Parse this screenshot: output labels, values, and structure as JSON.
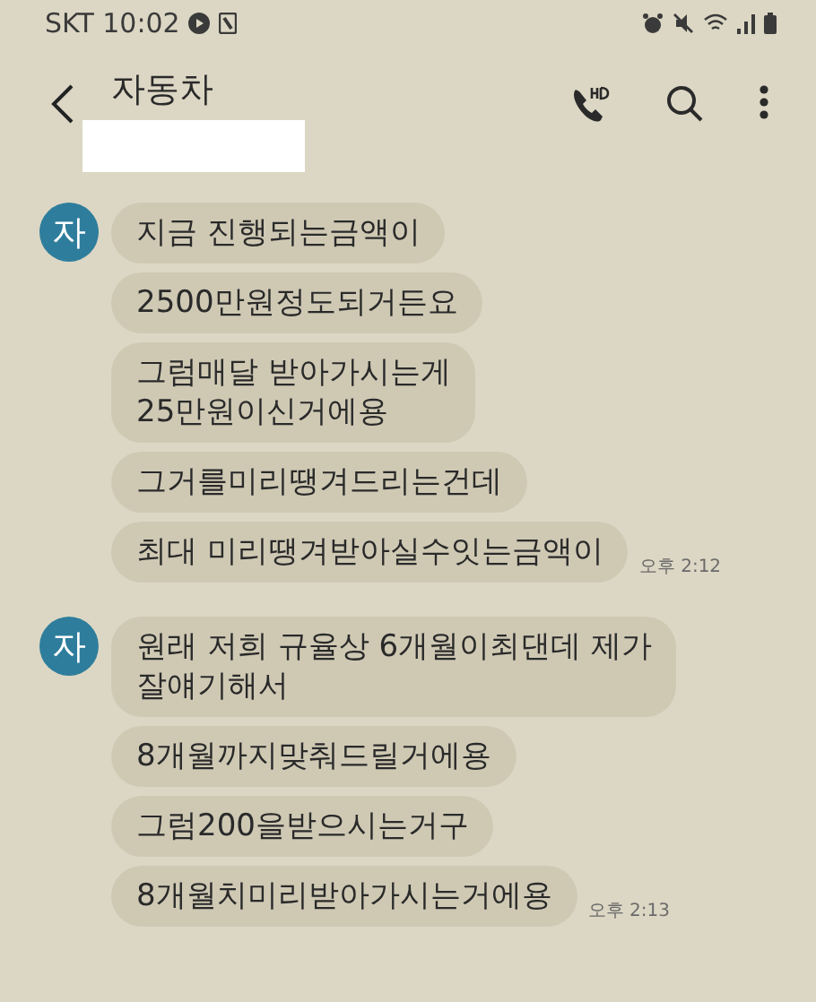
{
  "status_bar": {
    "carrier": "SKT",
    "time": "10:02"
  },
  "header": {
    "title": "자동차"
  },
  "groups": [
    {
      "avatar": "자",
      "messages": [
        "지금 진행되는금액이",
        "2500만원정도되거든요",
        "그럼매달 받아가시는게\n25만원이신거에용",
        "그거를미리땡겨드리는건데",
        "최대 미리땡겨받아실수잇는금액이"
      ],
      "time": "오후 2:12"
    },
    {
      "avatar": "자",
      "messages": [
        "원래 저희 규율상 6개월이최댄데 제가\n잘얘기해서",
        "8개월까지맞춰드릴거에용",
        "그럼200을받으시는거구",
        "8개월치미리받아가시는거에용"
      ],
      "time": "오후 2:13"
    }
  ]
}
